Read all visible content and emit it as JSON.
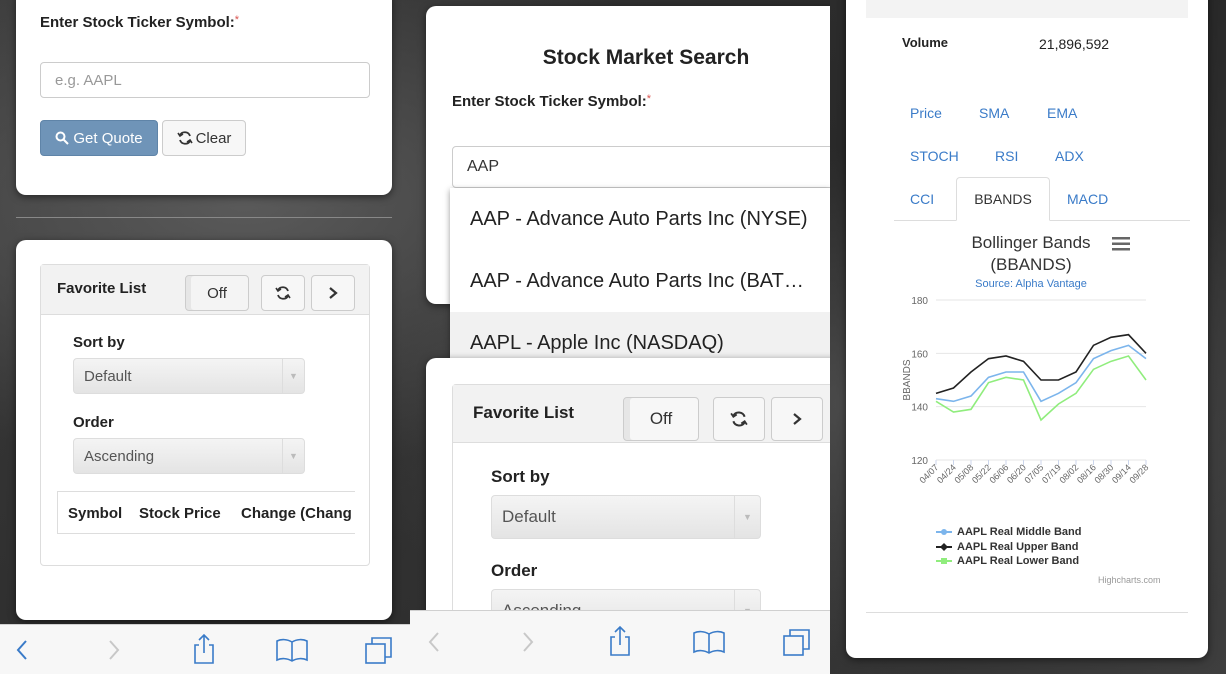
{
  "panel1": {
    "ticker_label": "Enter Stock Ticker Symbol:",
    "required_mark": "*",
    "ticker_placeholder": "e.g. AAPL",
    "get_quote_label": "Get Quote",
    "clear_label": "Clear",
    "favorite_title": "Favorite List",
    "toggle_label": "Off",
    "sort_by_label": "Sort by",
    "sort_by_value": "Default",
    "order_label": "Order",
    "order_value": "Ascending",
    "table_headers": [
      "Symbol",
      "Stock Price",
      "Change (Chang"
    ]
  },
  "panel2": {
    "title": "Stock Market Search",
    "ticker_label": "Enter Stock Ticker Symbol:",
    "required_mark": "*",
    "ticker_value": "AAP",
    "suggestions": [
      "AAP - Advance Auto Parts Inc (NYSE)",
      "AAP - Advance Auto Parts Inc (BAT…",
      "AAPL - Apple Inc (NASDAQ)"
    ],
    "favorite_title": "Favorite List",
    "toggle_label": "Off",
    "sort_by_label": "Sort by",
    "sort_by_value": "Default",
    "order_label": "Order",
    "order_value": "Ascending"
  },
  "panel3": {
    "volume_label": "Volume",
    "volume_value": "21,896,592",
    "tabs_row1": [
      "Price",
      "SMA",
      "EMA"
    ],
    "tabs_row2": [
      "STOCH",
      "RSI",
      "ADX"
    ],
    "tabs_row3": [
      "CCI",
      "BBANDS",
      "MACD"
    ],
    "active_tab": "BBANDS",
    "accent_color": "#3a7bc8",
    "credit": "Highcharts.com"
  },
  "chart_data": {
    "type": "line",
    "title": "Bollinger Bands (BBANDS)",
    "title_line1": "Bollinger Bands",
    "title_line2": "(BBANDS)",
    "subtitle": "Source: Alpha Vantage",
    "ylabel": "BBANDS",
    "ylim": [
      120,
      180
    ],
    "yticks": [
      120,
      140,
      160,
      180
    ],
    "x": [
      "04/07",
      "04/24",
      "05/08",
      "05/22",
      "06/06",
      "06/20",
      "07/05",
      "07/19",
      "08/02",
      "08/16",
      "08/30",
      "09/14",
      "09/28"
    ],
    "grid": true,
    "legend_position": "bottom",
    "series": [
      {
        "name": "AAPL Real Middle Band",
        "color": "#7cb5ec",
        "values": [
          143,
          142,
          144,
          151,
          153,
          153,
          142,
          145,
          149,
          158,
          161,
          163,
          158
        ]
      },
      {
        "name": "AAPL Real Upper Band",
        "color": "#222222",
        "values": [
          145,
          147,
          153,
          158,
          159,
          157,
          150,
          150,
          153,
          163,
          166,
          167,
          160
        ]
      },
      {
        "name": "AAPL Real Lower Band",
        "color": "#90ed7d",
        "values": [
          142,
          138,
          139,
          149,
          151,
          150,
          135,
          141,
          145,
          154,
          157,
          159,
          150
        ]
      }
    ]
  }
}
